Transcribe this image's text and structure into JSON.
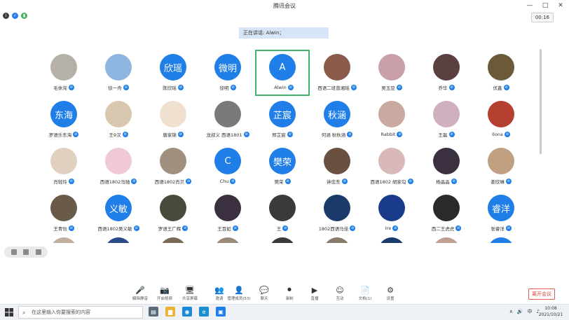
{
  "window": {
    "title": "腾讯会议",
    "controls": [
      "—",
      "□",
      "✕"
    ]
  },
  "info_icons": [
    {
      "name": "info-icon",
      "color": "#3c3c3c",
      "glyph": "i"
    },
    {
      "name": "shield-icon",
      "color": "#2b7de9",
      "glyph": "✓"
    },
    {
      "name": "signal-icon",
      "color": "#41b35d",
      "glyph": "▮"
    }
  ],
  "timer": "00:16",
  "speaker": {
    "label": "正在讲话: Alwin；"
  },
  "participants": [
    {
      "name": "毛休洵",
      "avatar_text": "",
      "color": "#b5b0a8"
    },
    {
      "name": "徐一舟",
      "avatar_text": "",
      "color": "#8fb6e0"
    },
    {
      "name": "陈欣瑶",
      "avatar_text": "欣瑶",
      "color": "#1f7ee8"
    },
    {
      "name": "徐明",
      "avatar_text": "微明",
      "color": "#1f7ee8"
    },
    {
      "name": "Alwin",
      "avatar_text": "A",
      "color": "#1f7ee8",
      "active": true
    },
    {
      "name": "西语二班曾湘瑶",
      "avatar_text": "",
      "color": "#8a5a4a"
    },
    {
      "name": "吴玉豆",
      "avatar_text": "",
      "color": "#c9a0a8"
    },
    {
      "name": "乔华",
      "avatar_text": "",
      "color": "#5a4040"
    },
    {
      "name": "伏鑫",
      "avatar_text": "",
      "color": "#6b5a3a"
    },
    {
      "name": "罗语乐东海",
      "avatar_text": "东海",
      "color": "#1f7ee8"
    },
    {
      "name": "王9汉",
      "avatar_text": "",
      "color": "#d8c8b0"
    },
    {
      "name": "唐家锦",
      "avatar_text": "",
      "color": "#f0e0d0"
    },
    {
      "name": "龙叔义 西语1801",
      "avatar_text": "",
      "color": "#7a7a7a"
    },
    {
      "name": "邢芷宸",
      "avatar_text": "芷宸",
      "color": "#1f7ee8"
    },
    {
      "name": "何涵 秋秋涵",
      "avatar_text": "秋涵",
      "color": "#1f7ee8"
    },
    {
      "name": "Rabbit",
      "avatar_text": "",
      "color": "#c9a9a0"
    },
    {
      "name": "王磊",
      "avatar_text": "",
      "color": "#d0b0c0"
    },
    {
      "name": "Ilona",
      "avatar_text": "",
      "color": "#b54030"
    },
    {
      "name": "肖轻玲",
      "avatar_text": "",
      "color": "#e0d0c0"
    },
    {
      "name": "西语1802马驰",
      "avatar_text": "",
      "color": "#f0c8d8"
    },
    {
      "name": "西语1802肖贝",
      "avatar_text": "",
      "color": "#a09080"
    },
    {
      "name": "Chu",
      "avatar_text": "C",
      "color": "#1f7ee8"
    },
    {
      "name": "樊荣",
      "avatar_text": "樊荣",
      "color": "#1f7ee8"
    },
    {
      "name": "钟忠东",
      "avatar_text": "",
      "color": "#6a5040"
    },
    {
      "name": "西语1802 胡家勾",
      "avatar_text": "",
      "color": "#d8b8b8"
    },
    {
      "name": "杨晶晶",
      "avatar_text": "",
      "color": "#3a3040"
    },
    {
      "name": "姜欣琳",
      "avatar_text": "",
      "color": "#c0a080"
    },
    {
      "name": "王青怡",
      "avatar_text": "",
      "color": "#6a5a4a"
    },
    {
      "name": "西语1802吴义敏",
      "avatar_text": "义敏",
      "color": "#1f7ee8"
    },
    {
      "name": "罗语王广辉",
      "avatar_text": "",
      "color": "#4a4a3a"
    },
    {
      "name": "王百如",
      "avatar_text": "",
      "color": "#3a3040"
    },
    {
      "name": "王",
      "avatar_text": "",
      "color": "#3a3a3a"
    },
    {
      "name": "1802西语马佳",
      "avatar_text": "",
      "color": "#1a3a6a"
    },
    {
      "name": "Ire",
      "avatar_text": "",
      "color": "#1a3a8a"
    },
    {
      "name": "西二王虎虎",
      "avatar_text": "",
      "color": "#2a2a2a"
    },
    {
      "name": "张睿洋",
      "avatar_text": "睿洋",
      "color": "#1f7ee8"
    }
  ],
  "partial_row_colors": [
    "#c0b0a0",
    "#2a4a8a",
    "#7a6a5a",
    "#9a8a7a",
    "#3a3a3a",
    "#8a7a6a",
    "#1a3a6a",
    "#c0a090",
    "#1f7ee8"
  ],
  "toolbar": [
    {
      "label": "解除静音",
      "name": "unmute-button",
      "glyph": "🎤"
    },
    {
      "label": "开启视频",
      "name": "start-video-button",
      "glyph": "📷"
    },
    {
      "label": "共享屏幕",
      "name": "share-screen-button",
      "glyph": "🖥"
    },
    {
      "label": "邀请",
      "name": "invite-button",
      "glyph": "👥"
    },
    {
      "label": "管理成员(53)",
      "name": "manage-members-button",
      "glyph": "👤"
    },
    {
      "label": "聊天",
      "name": "chat-button",
      "glyph": "💬"
    },
    {
      "label": "录制",
      "name": "record-button",
      "glyph": "⏺"
    },
    {
      "label": "直播",
      "name": "live-button",
      "glyph": "▶"
    },
    {
      "label": "互动",
      "name": "reactions-button",
      "glyph": "☺"
    },
    {
      "label": "文档(1)",
      "name": "documents-button",
      "glyph": "📄"
    },
    {
      "label": "设置",
      "name": "settings-button",
      "glyph": "⚙"
    }
  ],
  "leave_label": "离开会议",
  "taskbar": {
    "search_placeholder": "在这里输入你要搜索的内容",
    "apps": [
      {
        "name": "task-view-icon",
        "color": "#5a6a7a",
        "glyph": "▤"
      },
      {
        "name": "file-explorer-icon",
        "color": "#e8b432",
        "glyph": "▆"
      },
      {
        "name": "media-app-icon",
        "color": "#1a8ad8",
        "glyph": "◉"
      },
      {
        "name": "edge-icon",
        "color": "#1d8fd0",
        "glyph": "e"
      },
      {
        "name": "meeting-app-icon",
        "color": "#1f7ee8",
        "glyph": "▣"
      }
    ],
    "tray": [
      "∧",
      "🔊",
      "中",
      "♪"
    ],
    "time": "10:08",
    "date": "2021/10/21"
  }
}
